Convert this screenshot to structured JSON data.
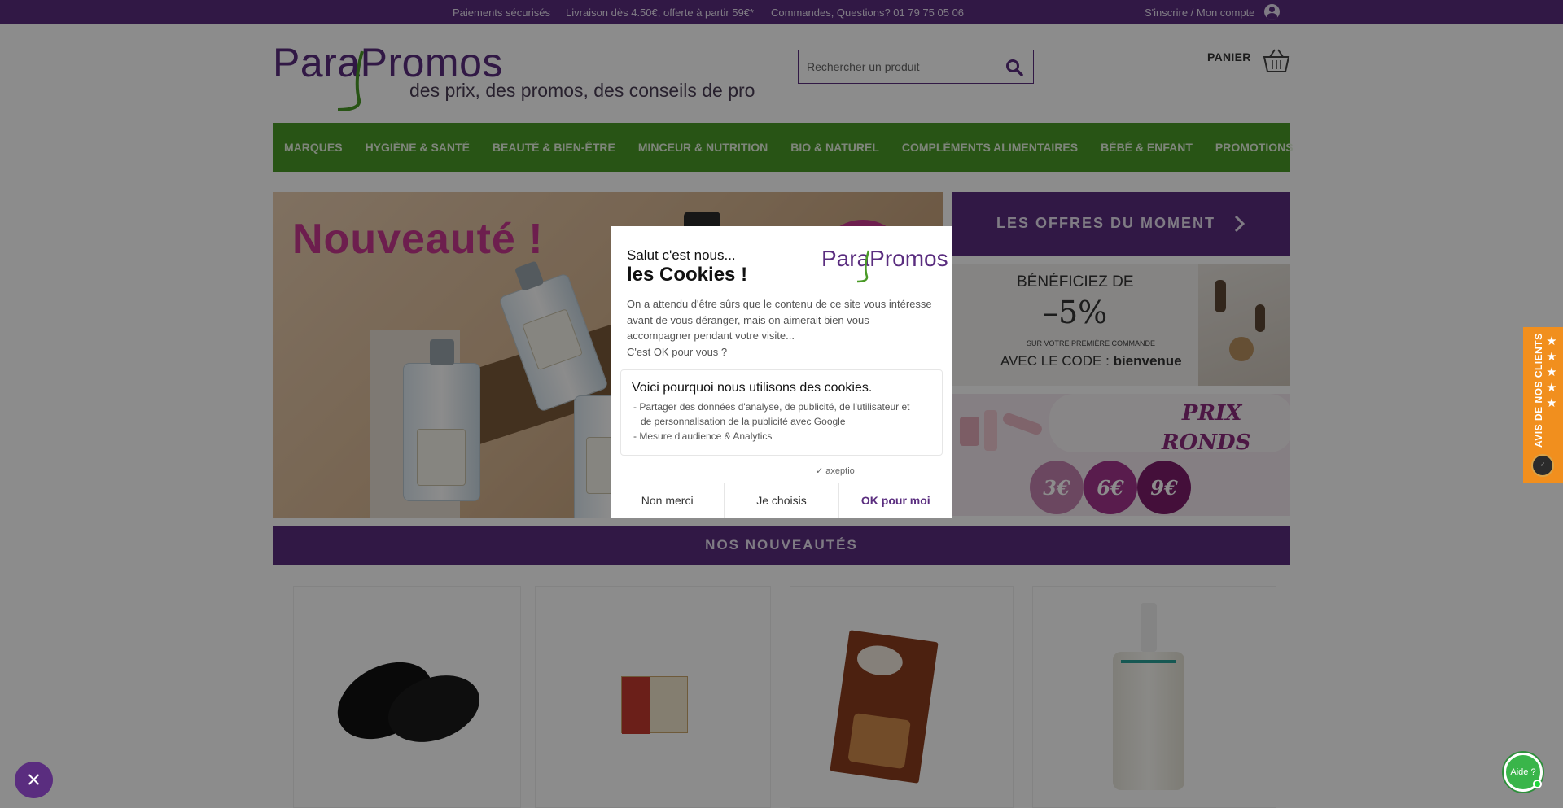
{
  "topbar": {
    "secure": "Paiements sécurisés",
    "shipping": "Livraison dès 4.50€, offerte à partir 59€*",
    "contact": "Commandes, Questions? 01 79 75 05 06",
    "account": "S'inscrire / Mon compte"
  },
  "header": {
    "brand": "ParaPromos",
    "tagline": "des prix, des promos, des conseils de pro",
    "search_placeholder": "Rechercher un produit",
    "cart_label": "PANIER"
  },
  "nav": {
    "items": [
      "MARQUES",
      "HYGIÈNE & SANTÉ",
      "BEAUTÉ & BIEN-ÊTRE",
      "MINCEUR & NUTRITION",
      "BIO & NATUREL",
      "COMPLÉMENTS ALIMENTAIRES",
      "BÉBÉ & ENFANT",
      "PROMOTIONS"
    ]
  },
  "hero": {
    "title": "Nouveauté !"
  },
  "side": {
    "offers": "LES OFFRES DU MOMENT",
    "promo1_line1": "BÉNÉFICIEZ DE",
    "promo1_discount": "–5%",
    "promo1_line3": "SUR VOTRE PREMIÈRE COMMANDE",
    "promo1_code_prefix": "AVEC LE CODE : ",
    "promo1_code": "bienvenue",
    "promo2_title_1": "PRIX",
    "promo2_title_2": "RONDS",
    "promo2_prices": [
      "3€",
      "6€",
      "9€"
    ]
  },
  "news": {
    "title": "NOS NOUVEAUTÉS"
  },
  "cookie": {
    "hello": "Salut c'est nous...",
    "title": "les Cookies !",
    "logo": "ParaPromos",
    "intro_1": "On a attendu d'être sûrs que le contenu de ce site vous intéresse",
    "intro_2": "avant de vous déranger, mais on aimerait bien vous",
    "intro_3": "accompagner pendant votre visite...",
    "intro_4": "C'est OK pour vous ?",
    "why_title": "Voici pourquoi nous utilisons des cookies.",
    "why_1": "- Partager des données d'analyse, de publicité, de l'utilisateur et",
    "why_2": "de personnalisation de la publicité avec Google",
    "why_3": "- Mesure d'audience & Analytics",
    "powered": "axeptio",
    "btn_no": "Non merci",
    "btn_choose": "Je choisis",
    "btn_ok": "OK pour moi"
  },
  "reviews": {
    "label": "AVIS DE NOS CLIENTS",
    "stars": 5
  },
  "help": {
    "label": "Aide ?"
  },
  "colors": {
    "purple": "#5a2d7f",
    "green": "#4a9a27",
    "pink": "#c6388f",
    "orange": "#f18f1e"
  }
}
